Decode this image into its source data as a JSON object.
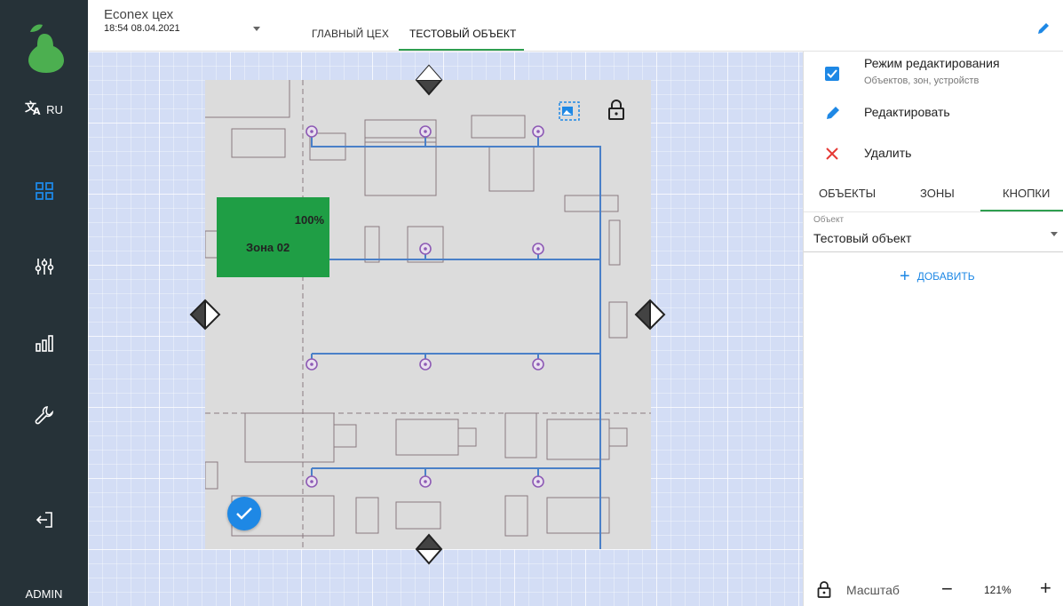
{
  "sidebar": {
    "language": "RU",
    "nav_icons": [
      "dashboard-icon",
      "sliders-icon",
      "bar-chart-icon",
      "wrench-icon",
      "logout-icon"
    ],
    "user": "ADMIN",
    "accent": "#1e88e5"
  },
  "header": {
    "site_name": "Econex цех",
    "datetime": "18:54 08.04.2021",
    "tabs": [
      "ГЛАВНЫЙ ЦЕХ",
      "ТЕСТОВЫЙ ОБЪЕКТ"
    ],
    "active_tab": "ТЕСТОВЫЙ ОБЪЕКТ"
  },
  "canvas": {
    "zone": {
      "percent": "100%",
      "name": "Зона 02",
      "color": "#1f9e45"
    }
  },
  "panel": {
    "edit_mode": {
      "checked": true,
      "title": "Режим редактирования",
      "subtitle": "Объектов, зон, устройств"
    },
    "actions": {
      "edit": "Редактировать",
      "delete": "Удалить"
    },
    "tabs": [
      "ОБЪЕКТЫ",
      "ЗОНЫ",
      "КНОПКИ"
    ],
    "active_tab": "КНОПКИ",
    "object_label": "Объект",
    "object_value": "Тестовый объект",
    "add_label": "ДОБАВИТЬ",
    "zoom_label": "Масштаб",
    "zoom_value": "121%"
  }
}
